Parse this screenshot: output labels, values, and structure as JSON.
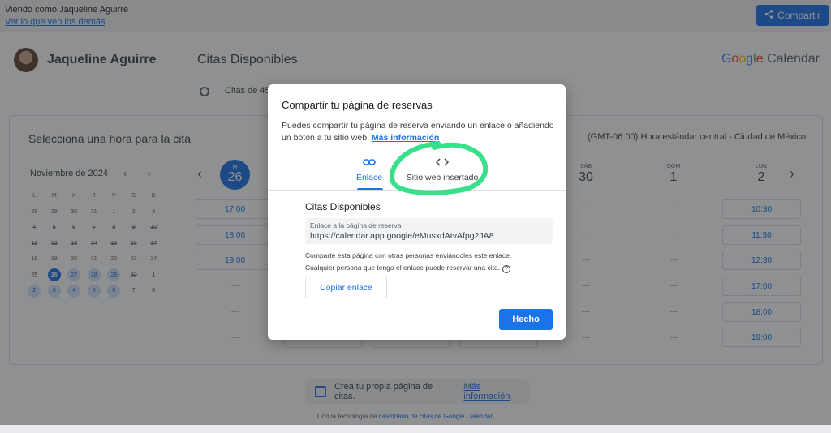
{
  "topbar": {
    "viewing_as": "Viendo como Jaqueline Aguirre",
    "view_link": "Ver lo que ven los demás",
    "share_label": "Compartir",
    "share_icon": "share-icon"
  },
  "header": {
    "user_name": "Jaqueline Aguirre",
    "title": "Citas Disponibles",
    "brand_google": [
      "G",
      "o",
      "o",
      "g",
      "l",
      "e"
    ],
    "brand_product": "Calendar",
    "duration_text": "Citas de 45"
  },
  "booking": {
    "select_label": "Selecciona una hora para la cita",
    "timezone": "(GMT-06:00) Hora estándar central - Ciudad de México"
  },
  "mini_calendar": {
    "month": "Noviembre de 2024",
    "weekday_headers": [
      "L",
      "M",
      "X",
      "J",
      "V",
      "S",
      "D"
    ],
    "days": [
      {
        "d": "28",
        "s": "past"
      },
      {
        "d": "29",
        "s": "past"
      },
      {
        "d": "30",
        "s": "past"
      },
      {
        "d": "31",
        "s": "past"
      },
      {
        "d": "1",
        "s": "past"
      },
      {
        "d": "2",
        "s": "past"
      },
      {
        "d": "3",
        "s": "past"
      },
      {
        "d": "4",
        "s": "past"
      },
      {
        "d": "5",
        "s": "past"
      },
      {
        "d": "6",
        "s": "past"
      },
      {
        "d": "7",
        "s": "past"
      },
      {
        "d": "8",
        "s": "past"
      },
      {
        "d": "9",
        "s": "past"
      },
      {
        "d": "10",
        "s": "past"
      },
      {
        "d": "11",
        "s": "past"
      },
      {
        "d": "12",
        "s": "past"
      },
      {
        "d": "13",
        "s": "past"
      },
      {
        "d": "14",
        "s": "past"
      },
      {
        "d": "15",
        "s": "past"
      },
      {
        "d": "16",
        "s": "past"
      },
      {
        "d": "17",
        "s": "past"
      },
      {
        "d": "18",
        "s": "past"
      },
      {
        "d": "19",
        "s": "past"
      },
      {
        "d": "20",
        "s": "past"
      },
      {
        "d": "21",
        "s": "past"
      },
      {
        "d": "22",
        "s": "past"
      },
      {
        "d": "23",
        "s": "past"
      },
      {
        "d": "24",
        "s": "past"
      },
      {
        "d": "25",
        "s": "plain"
      },
      {
        "d": "26",
        "s": "sel"
      },
      {
        "d": "27",
        "s": "avail"
      },
      {
        "d": "28",
        "s": "avail"
      },
      {
        "d": "29",
        "s": "avail"
      },
      {
        "d": "30",
        "s": "past"
      },
      {
        "d": "1",
        "s": "plain"
      },
      {
        "d": "2",
        "s": "avail"
      },
      {
        "d": "3",
        "s": "avail"
      },
      {
        "d": "4",
        "s": "avail"
      },
      {
        "d": "5",
        "s": "avail"
      },
      {
        "d": "6",
        "s": "avail"
      },
      {
        "d": "7",
        "s": "plain"
      },
      {
        "d": "8",
        "s": "plain"
      }
    ]
  },
  "week": {
    "selected_day": {
      "name": "M",
      "date": "26"
    },
    "days": [
      {
        "name": "SÁB",
        "date": "30"
      },
      {
        "name": "DOM",
        "date": "1"
      },
      {
        "name": "LUN",
        "date": "2"
      }
    ],
    "first_col_slots": [
      "17:00",
      "18:00",
      "19:00"
    ],
    "last_col_slots": [
      "10:30",
      "11:30",
      "12:30",
      "17:00",
      "18:00",
      "19:00"
    ],
    "dash": "—"
  },
  "footer": {
    "create_text": "Crea tu propia página de citas.",
    "more_info": "Más información",
    "powered_prefix": "Con la tecnología de ",
    "powered_link": "calendario de citas de Google Calendar"
  },
  "dialog": {
    "title": "Compartir tu página de reservas",
    "description": "Puedes compartir tu página de reserva enviando un enlace o añadiendo un botón a tu sitio web.",
    "more_info": "Más información",
    "tab_link": "Enlace",
    "tab_embed": "Sitio web insertado",
    "subtitle": "Citas Disponibles",
    "link_label": "Enlace a la página de reserva",
    "link_url": "https://calendar.app.google/eMusxdAtvAfpg2JA8",
    "share_note_1": "Comparte esta página con otras personas enviándoles este enlace.",
    "share_note_2": "Cualquier persona que tenga el enlace puede reservar una cita.",
    "copy_button": "Copiar enlace",
    "done_button": "Hecho"
  },
  "colors": {
    "accent": "#1a73e8",
    "highlight_marker": "#39e08a"
  }
}
